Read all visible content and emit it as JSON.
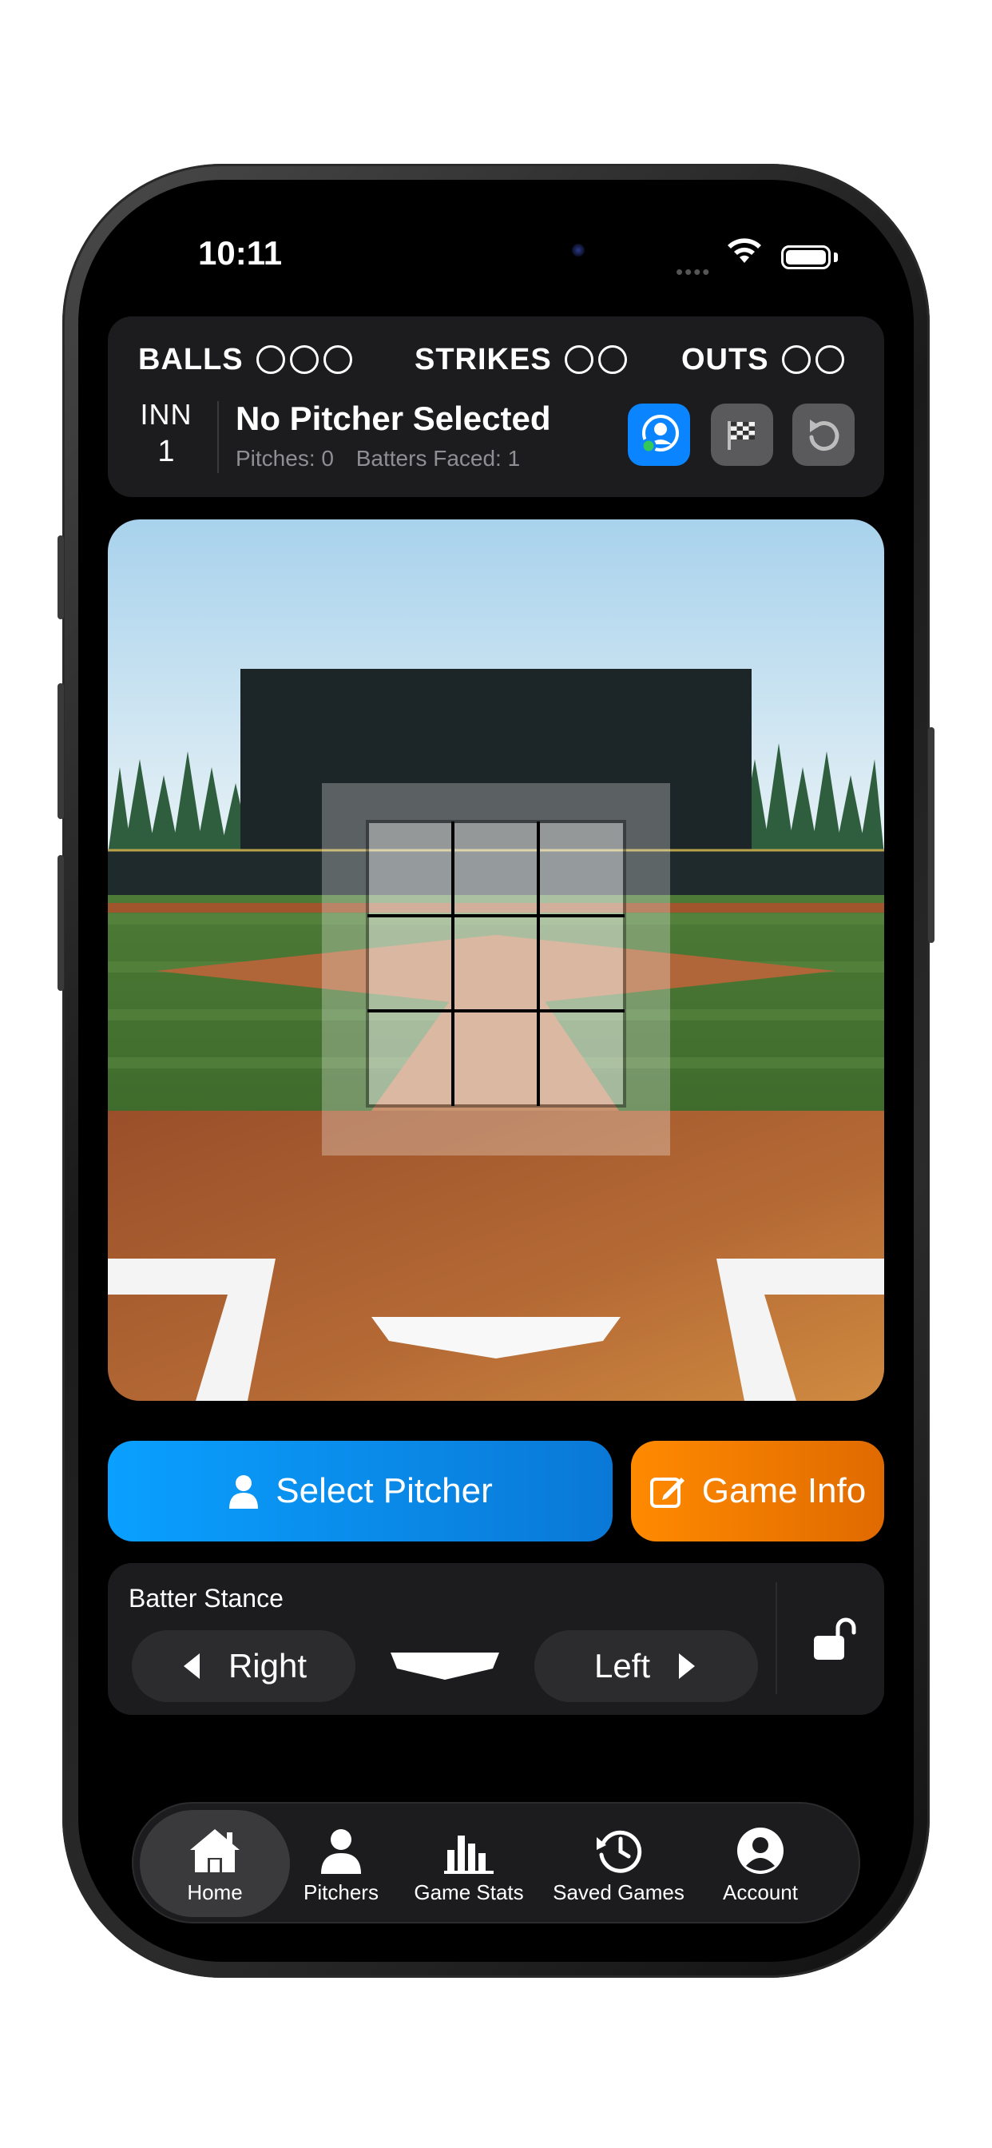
{
  "status_bar": {
    "time": "10:11"
  },
  "scoreboard": {
    "balls_label": "BALLS",
    "strikes_label": "STRIKES",
    "outs_label": "OUTS",
    "balls": 0,
    "strikes": 0,
    "outs": 0,
    "inning_label": "INN",
    "inning": "1",
    "pitcher_name": "No Pitcher Selected",
    "pitches": "Pitches: 0",
    "batters_faced": "Batters Faced: 1"
  },
  "actions": {
    "select_pitcher_label": "Select Pitcher",
    "game_info_label": "Game Info"
  },
  "batter_stance": {
    "title": "Batter Stance",
    "right_label": "Right",
    "left_label": "Left"
  },
  "tabs": [
    {
      "label": "Home",
      "icon": "house-icon",
      "selected": true
    },
    {
      "label": "Pitchers",
      "icon": "person-icon",
      "selected": false
    },
    {
      "label": "Game Stats",
      "icon": "bar-chart-icon",
      "selected": false
    },
    {
      "label": "Saved Games",
      "icon": "history-clock-icon",
      "selected": false
    },
    {
      "label": "Account",
      "icon": "account-circle-icon",
      "selected": false
    }
  ],
  "colors": {
    "accent_blue": "#0a84ff",
    "accent_orange": "#ff8a00",
    "panel": "#1c1c1e"
  }
}
